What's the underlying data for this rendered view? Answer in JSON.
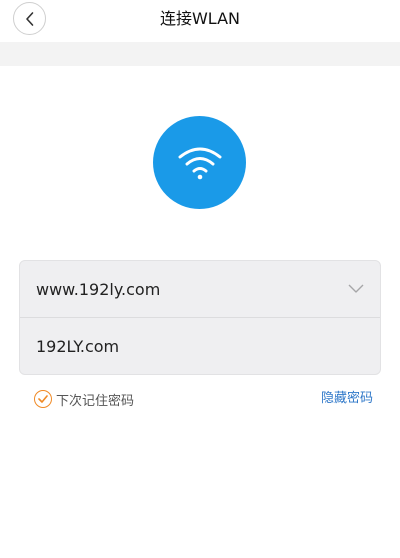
{
  "header": {
    "title": "连接WLAN",
    "back_icon": "chevron-left-icon"
  },
  "wifi": {
    "icon": "wifi-icon",
    "color": "#1a9ae8"
  },
  "form": {
    "ssid_value": "www.192ly.com",
    "password_value": "192LY.com",
    "dropdown_icon": "chevron-down-icon"
  },
  "options": {
    "remember_label": "下次记住密码",
    "remember_checked": true,
    "hide_password_label": "隐藏密码",
    "accent_color": "#f08a26",
    "link_color": "#2f78c9"
  }
}
